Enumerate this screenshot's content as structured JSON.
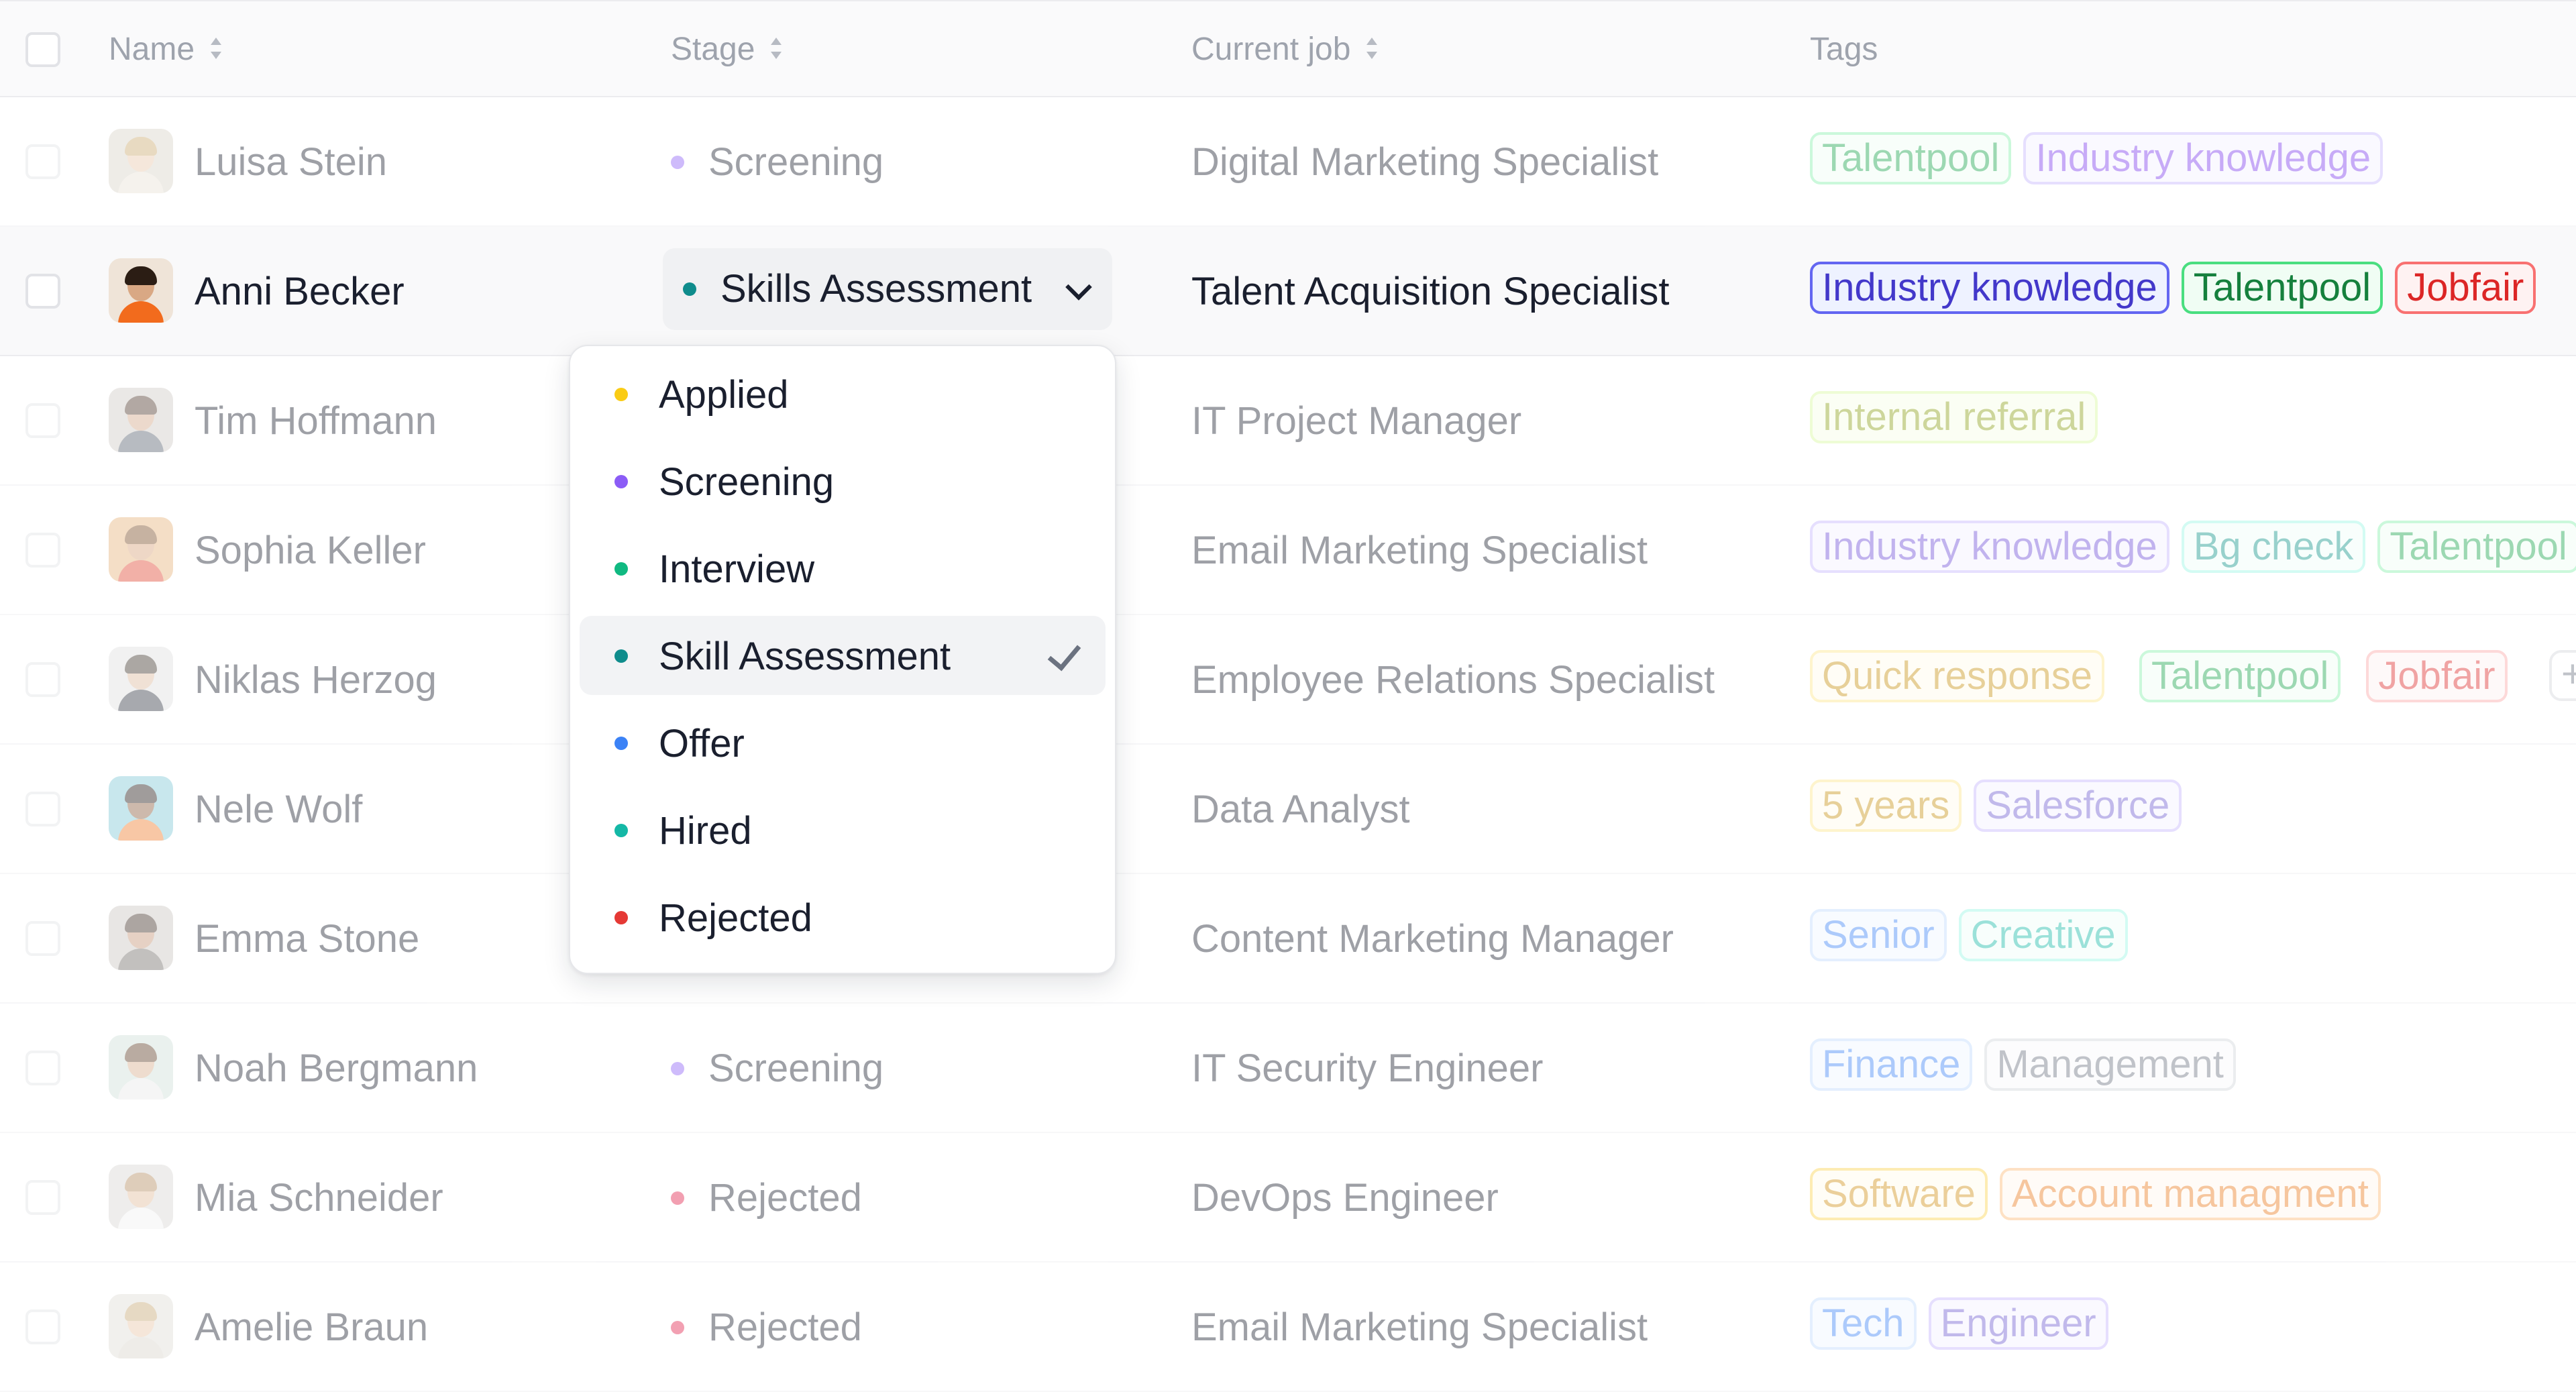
{
  "columns": {
    "name": "Name",
    "stage": "Stage",
    "current_job": "Current job",
    "tags": "Tags"
  },
  "rows": [
    {
      "name": "Luisa Stein",
      "stage": "Screening",
      "stage_color": "#8b5cf6",
      "job": "Digital Marketing Specialist",
      "tags": [
        {
          "label": "Talentpool",
          "color": "#16a34a"
        },
        {
          "label": "Industry knowledge",
          "color": "#7c3aed"
        }
      ]
    },
    {
      "name": "Anni Becker",
      "stage": "Skills Assessment",
      "stage_color": "#0f8c8c",
      "job": "Talent Acquisition Specialist",
      "tags": [
        {
          "label": "Industry knowledge",
          "color": "#4338ca"
        },
        {
          "label": "Talentpool",
          "color": "#15803d"
        },
        {
          "label": "Jobfair",
          "color": "#dc2626"
        }
      ]
    },
    {
      "name": "Tim Hoffmann",
      "job": "IT Project Manager",
      "tags": [
        {
          "label": "Internal referral",
          "color": "#9bb01a"
        }
      ]
    },
    {
      "name": "Sophia Keller",
      "job": "Email Marketing Specialist",
      "tags": [
        {
          "label": "Industry knowledge",
          "color": "#6d4bd8"
        },
        {
          "label": "Bg check",
          "color": "#0d9488"
        },
        {
          "label": "Talentpool",
          "color": "#16a34a"
        }
      ]
    },
    {
      "name": "Niklas Herzog",
      "job": "Employee Relations Specialist",
      "tags": [
        {
          "label": "Quick response",
          "color": "#d4a017"
        },
        {
          "label": "Talentpool",
          "color": "#16a34a"
        },
        {
          "label": "Jobfair",
          "color": "#dc2626"
        }
      ],
      "more": "+"
    },
    {
      "name": "Nele Wolf",
      "job": "Data Analyst",
      "tags": [
        {
          "label": "5 years",
          "color": "#d4a017"
        },
        {
          "label": "Salesforce",
          "color": "#6d5bd0"
        }
      ]
    },
    {
      "name": "Emma Stone",
      "job": "Content Marketing Manager",
      "tags": [
        {
          "label": "Senior",
          "color": "#3b82f6"
        },
        {
          "label": "Creative",
          "color": "#14b8a6"
        }
      ]
    },
    {
      "name": "Noah Bergmann",
      "stage": "Screening",
      "stage_color": "#8b5cf6",
      "job": "IT Security Engineer",
      "tags": [
        {
          "label": "Finance",
          "color": "#3b82f6"
        },
        {
          "label": "Management",
          "color": "#6b7280"
        }
      ]
    },
    {
      "name": "Mia Schneider",
      "stage": "Rejected",
      "stage_color": "#e11d48",
      "job": "DevOps Engineer",
      "tags": [
        {
          "label": "Software",
          "color": "#e0a21a"
        },
        {
          "label": "Account managment",
          "color": "#ea7a1a"
        }
      ]
    },
    {
      "name": "Amelie Braun",
      "stage": "Rejected",
      "stage_color": "#e11d48",
      "job": "Email Marketing Specialist",
      "tags": [
        {
          "label": "Tech",
          "color": "#3b82f6"
        },
        {
          "label": "Engineer",
          "color": "#6d5bd0"
        }
      ]
    }
  ],
  "dropdown": {
    "options": [
      {
        "label": "Applied",
        "color": "#facc15"
      },
      {
        "label": "Screening",
        "color": "#8b5cf6"
      },
      {
        "label": "Interview",
        "color": "#10b981"
      },
      {
        "label": "Skill Assessment",
        "color": "#0f8c8c",
        "selected": true
      },
      {
        "label": "Offer",
        "color": "#3b82f6"
      },
      {
        "label": "Hired",
        "color": "#14b8a6"
      },
      {
        "label": "Rejected",
        "color": "#e53935"
      }
    ]
  }
}
